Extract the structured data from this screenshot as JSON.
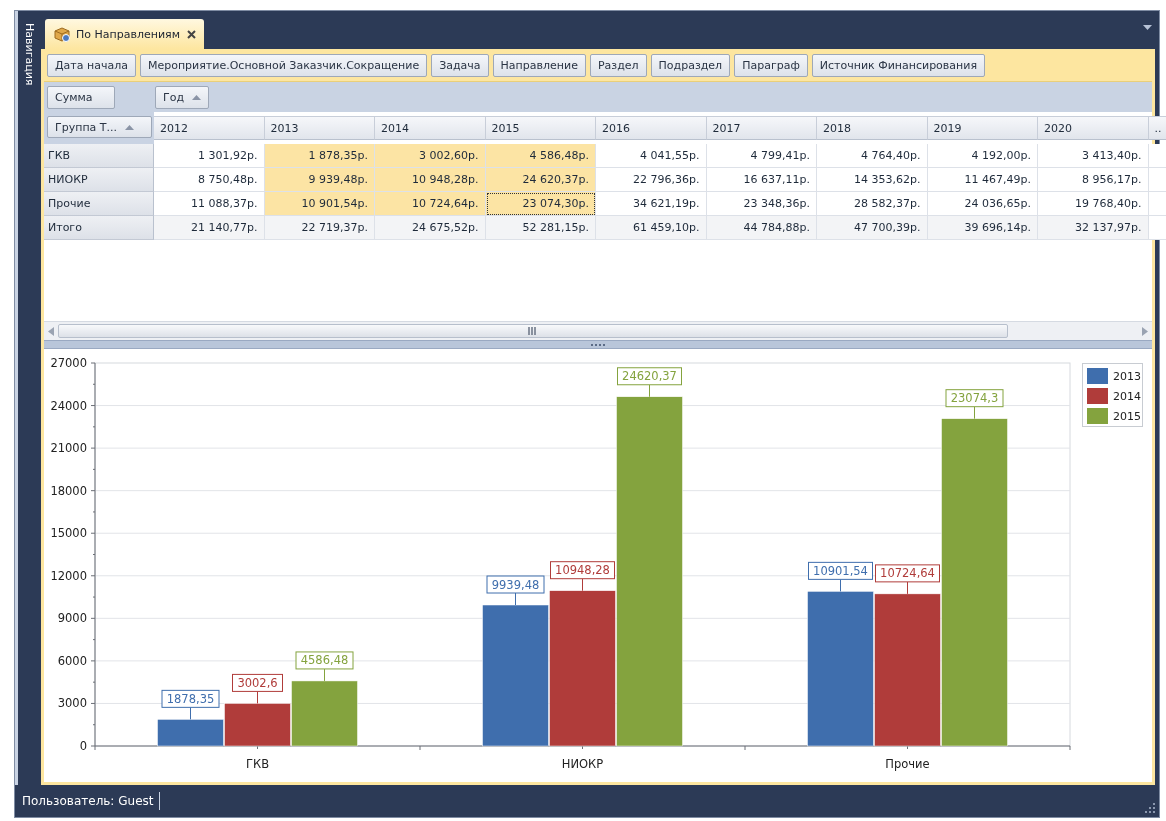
{
  "navigation": {
    "label": "Навигация"
  },
  "tab": {
    "title": "По Направлениям",
    "selected": true
  },
  "filter_fields": [
    "Дата начала",
    "Мероприятие.Основной Заказчик.Сокращение",
    "Задача",
    "Направление",
    "Раздел",
    "Подраздел",
    "Параграф",
    "Источник Финансирования"
  ],
  "data_fields": [
    "Сумма"
  ],
  "column_fields": [
    "Год"
  ],
  "row_fields": [
    "Группа Т..."
  ],
  "table": {
    "columns": [
      "2012",
      "2013",
      "2014",
      "2015",
      "2016",
      "2017",
      "2018",
      "2019",
      "2020",
      ".."
    ],
    "rows": [
      {
        "kind": "data",
        "label": "ГКВ",
        "cells": [
          {
            "value": "1 301,92р.",
            "selected": false,
            "focused": false
          },
          {
            "value": "1 878,35р.",
            "selected": true,
            "focused": false
          },
          {
            "value": "3 002,60р.",
            "selected": true,
            "focused": false
          },
          {
            "value": "4 586,48р.",
            "selected": true,
            "focused": false
          },
          {
            "value": "4 041,55р.",
            "selected": false,
            "focused": false
          },
          {
            "value": "4 799,41р.",
            "selected": false,
            "focused": false
          },
          {
            "value": "4 764,40р.",
            "selected": false,
            "focused": false
          },
          {
            "value": "4 192,00р.",
            "selected": false,
            "focused": false
          },
          {
            "value": "3 413,40р.",
            "selected": false,
            "focused": false
          }
        ]
      },
      {
        "kind": "data",
        "label": "НИОКР",
        "cells": [
          {
            "value": "8 750,48р.",
            "selected": false,
            "focused": false
          },
          {
            "value": "9 939,48р.",
            "selected": true,
            "focused": false
          },
          {
            "value": "10 948,28р.",
            "selected": true,
            "focused": false
          },
          {
            "value": "24 620,37р.",
            "selected": true,
            "focused": false
          },
          {
            "value": "22 796,36р.",
            "selected": false,
            "focused": false
          },
          {
            "value": "16 637,11р.",
            "selected": false,
            "focused": false
          },
          {
            "value": "14 353,62р.",
            "selected": false,
            "focused": false
          },
          {
            "value": "11 467,49р.",
            "selected": false,
            "focused": false
          },
          {
            "value": "8 956,17р.",
            "selected": false,
            "focused": false
          }
        ]
      },
      {
        "kind": "data",
        "label": "Прочие",
        "cells": [
          {
            "value": "11 088,37р.",
            "selected": false,
            "focused": false
          },
          {
            "value": "10 901,54р.",
            "selected": true,
            "focused": false
          },
          {
            "value": "10 724,64р.",
            "selected": true,
            "focused": false
          },
          {
            "value": "23 074,30р.",
            "selected": true,
            "focused": true
          },
          {
            "value": "34 621,19р.",
            "selected": false,
            "focused": false
          },
          {
            "value": "23 348,36р.",
            "selected": false,
            "focused": false
          },
          {
            "value": "28 582,37р.",
            "selected": false,
            "focused": false
          },
          {
            "value": "24 036,65р.",
            "selected": false,
            "focused": false
          },
          {
            "value": "19 768,40р.",
            "selected": false,
            "focused": false
          }
        ]
      },
      {
        "kind": "total",
        "label": "Итого",
        "cells": [
          {
            "value": "21 140,77р.",
            "selected": false,
            "focused": false
          },
          {
            "value": "22 719,37р.",
            "selected": false,
            "focused": false
          },
          {
            "value": "24 675,52р.",
            "selected": false,
            "focused": false
          },
          {
            "value": "52 281,15р.",
            "selected": false,
            "focused": false
          },
          {
            "value": "61 459,10р.",
            "selected": false,
            "focused": false
          },
          {
            "value": "44 784,88р.",
            "selected": false,
            "focused": false
          },
          {
            "value": "47 700,39р.",
            "selected": false,
            "focused": false
          },
          {
            "value": "39 696,14р.",
            "selected": false,
            "focused": false
          },
          {
            "value": "32 137,97р.",
            "selected": false,
            "focused": false
          }
        ]
      }
    ]
  },
  "chart": {
    "chart_data": {
      "type": "bar",
      "categories": [
        "ГКВ",
        "НИОКР",
        "Прочие"
      ],
      "series": [
        {
          "name": "2013",
          "color": "#3f6ead",
          "values": [
            1878.35,
            9939.48,
            10901.54
          ],
          "value_labels": [
            "1878,35",
            "9939,48",
            "10901,54"
          ]
        },
        {
          "name": "2014",
          "color": "#b03c3a",
          "values": [
            3002.6,
            10948.28,
            10724.64
          ],
          "value_labels": [
            "3002,6",
            "10948,28",
            "10724,64"
          ]
        },
        {
          "name": "2015",
          "color": "#84a33e",
          "values": [
            4586.48,
            24620.37,
            23074.3
          ],
          "value_labels": [
            "4586,48",
            "24620,37",
            "23074,3"
          ]
        }
      ],
      "ylim": [
        0,
        27000
      ],
      "yticks": [
        0,
        3000,
        6000,
        9000,
        12000,
        15000,
        18000,
        21000,
        24000,
        27000
      ],
      "grid": true,
      "legend": true
    }
  },
  "status_bar": {
    "user": "Пользователь: Guest"
  }
}
